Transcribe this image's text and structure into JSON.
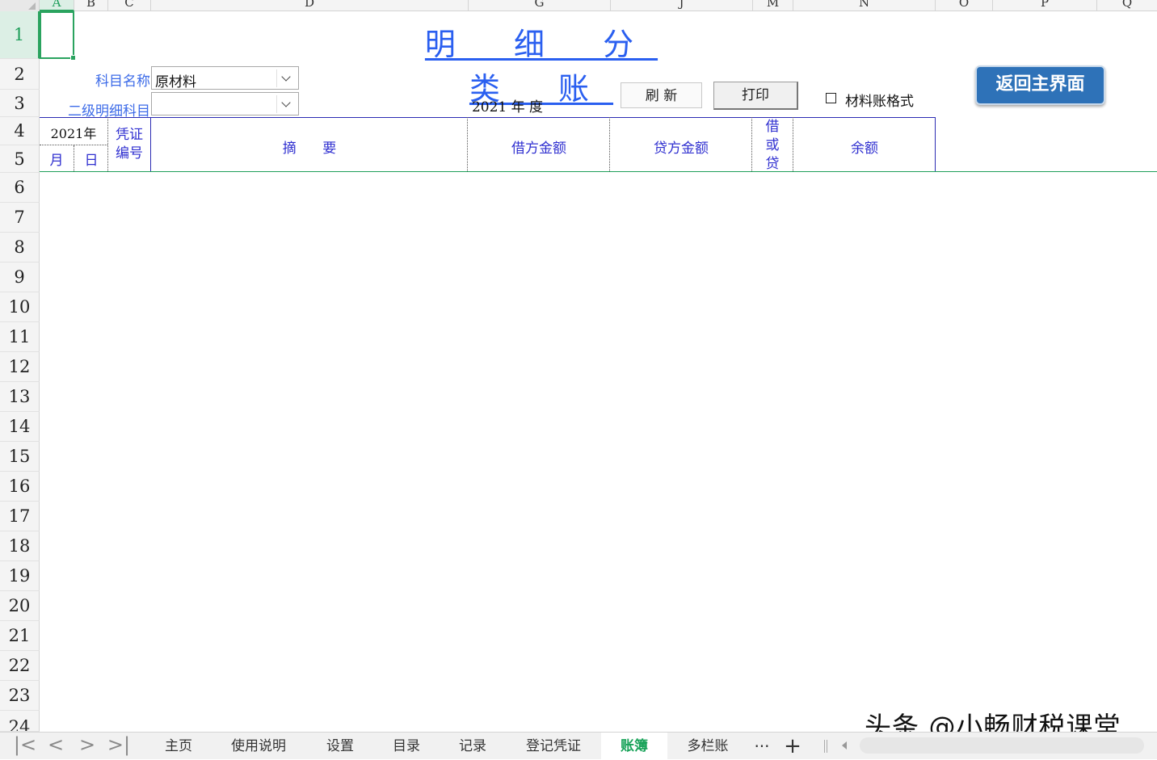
{
  "columns": [
    "A",
    "B",
    "C",
    "D",
    "G",
    "J",
    "M",
    "N",
    "O",
    "P",
    "Q"
  ],
  "rows": [
    "1",
    "2",
    "3",
    "4",
    "5",
    "6",
    "7",
    "8",
    "9",
    "10",
    "11",
    "12",
    "13",
    "14",
    "15",
    "16",
    "17",
    "18",
    "19",
    "20",
    "21",
    "22",
    "23",
    "24"
  ],
  "title": "明 细 分 类 账",
  "subject_label": "科目名称",
  "subject_value": "原材料",
  "sub_subject_label": "二级明细科目",
  "sub_subject_value": "",
  "year_text": "2021 年 度",
  "refresh_label": "刷  新",
  "print_label": "打印",
  "material_format_label": "材料账格式",
  "home_button_label": "返回主界面",
  "ledger_header": {
    "year": "2021年",
    "month": "月",
    "day": "日",
    "voucher": "凭证编号",
    "summary": "摘      要",
    "debit": "借方金额",
    "credit": "贷方金额",
    "dc": "借或贷",
    "balance": "余额"
  },
  "sheet_tabs": [
    "主页",
    "使用说明",
    "设置",
    "目录",
    "记录",
    "登记凭证",
    "账簿",
    "多栏账"
  ],
  "active_tab": "账簿",
  "tab_more": "···",
  "tab_add": "+",
  "watermark": "头条 @小畅财税课堂",
  "colors": {
    "title": "#2a5ff0",
    "label": "#3c6be8",
    "header_text": "#3030d0",
    "home_button": "#2e72b8",
    "selection": "#2aa35f"
  }
}
